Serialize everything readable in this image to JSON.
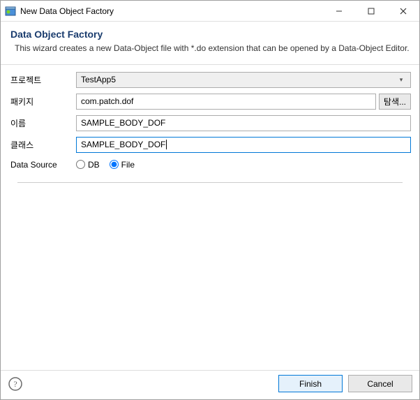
{
  "titlebar": {
    "title": "New Data Object Factory"
  },
  "header": {
    "title": "Data Object Factory",
    "desc": "This wizard creates a new Data-Object file with *.do extension that can be opened by a Data-Object Editor."
  },
  "form": {
    "project_label": "프로젝트",
    "project_value": "TestApp5",
    "package_label": "패키지",
    "package_value": "com.patch.dof",
    "browse_label": "탐색...",
    "name_label": "이름",
    "name_value": "SAMPLE_BODY_DOF",
    "class_label": "클래스",
    "class_value": "SAMPLE_BODY_DOF",
    "datasource_label": "Data Source",
    "ds_db_label": "DB",
    "ds_file_label": "File",
    "ds_selected": "file"
  },
  "footer": {
    "finish_label": "Finish",
    "cancel_label": "Cancel"
  }
}
